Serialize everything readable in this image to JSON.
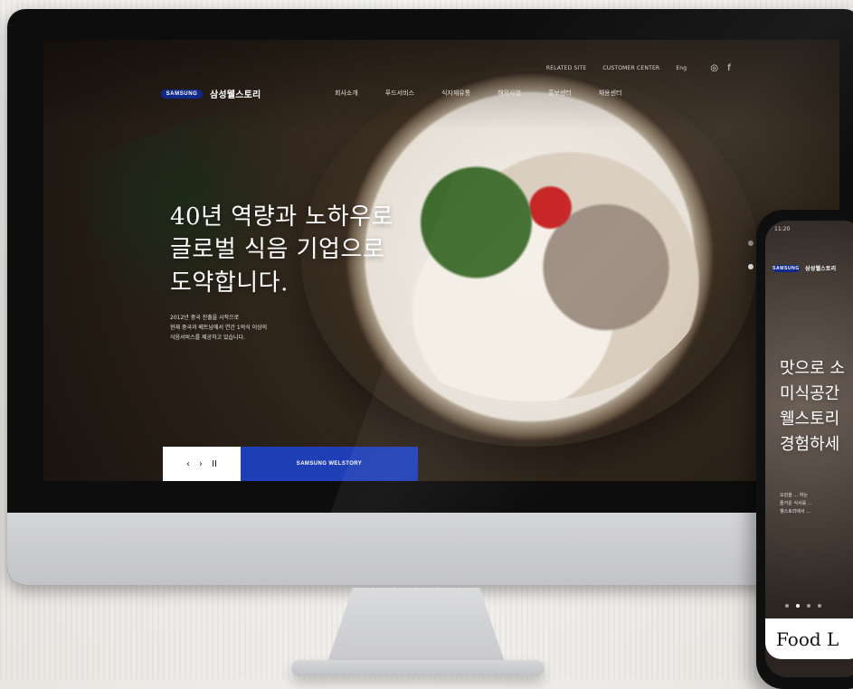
{
  "desktop": {
    "utility_links": [
      "RELATED SITE",
      "CUSTOMER CENTER",
      "Eng"
    ],
    "social_icons": [
      "instagram-icon",
      "facebook-icon"
    ],
    "brand": {
      "logo_text": "SAMSUNG",
      "brand_name": "삼성웰스토리"
    },
    "nav_items": [
      "회사소개",
      "푸드서비스",
      "식자재유통",
      "해외사업",
      "홍보센터",
      "채용센터"
    ],
    "hero": {
      "headline_lines": [
        "40년 역량과 노하우로",
        "글로벌 식음 기업으로",
        "도약합니다."
      ],
      "description_lines": [
        "2012년 중국 진출을 시작으로",
        "현재 중국과 베트남에서 연간 1억식 이상의",
        "식음서비스를 제공하고 있습니다."
      ]
    },
    "slider": {
      "controls": [
        "‹",
        "›",
        "II"
      ],
      "cta_label": "SAMSUNG WELSTORY"
    },
    "vertical_pagination_count": 2
  },
  "phone": {
    "status_time": "11:20",
    "brand": {
      "logo_text": "SAMSUNG",
      "brand_name": "삼성웰스토리"
    },
    "hero_lines": [
      "맛으로 소",
      "미식공간",
      "웰스토리",
      "경험하세"
    ],
    "sub_lines": [
      "오감을 ... 하는",
      "즐거운 식사를 ...",
      "웰스토리에서 ..."
    ],
    "pagination_count": 4,
    "footer_label": "Food L"
  },
  "colors": {
    "brand_blue": "#1f3fb7",
    "samsung_blue": "#0f2a8a"
  }
}
